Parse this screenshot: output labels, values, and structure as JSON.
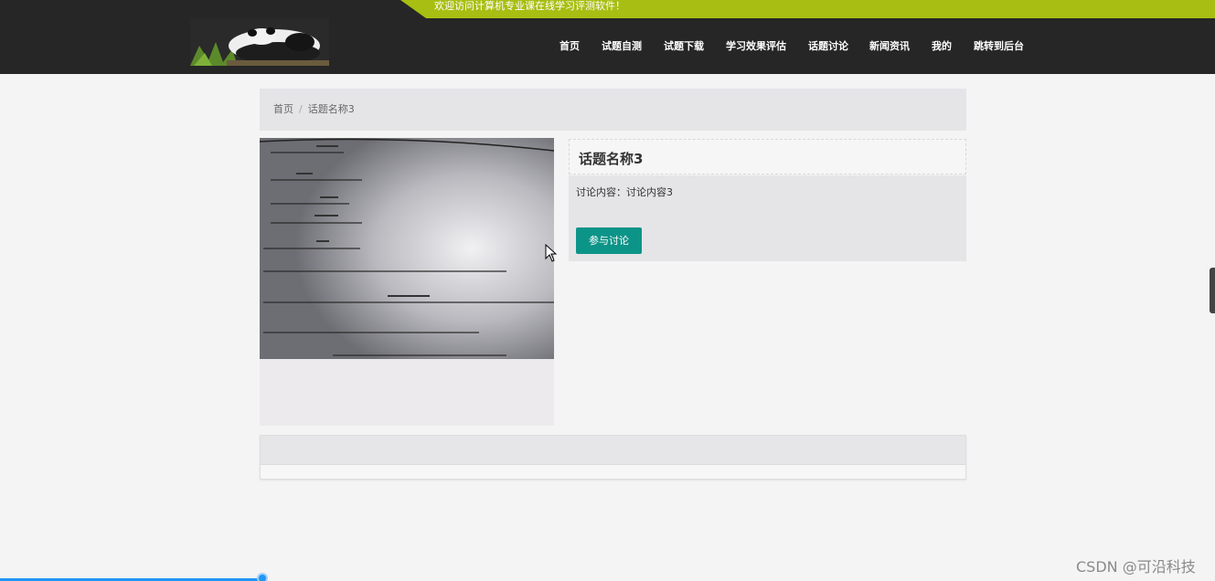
{
  "header": {
    "welcome": "欢迎访问计算机专业课在线学习评测软件！",
    "logo": "panda-logo",
    "nav": [
      {
        "label": "首页"
      },
      {
        "label": "试题自测"
      },
      {
        "label": "试题下载"
      },
      {
        "label": "学习效果评估"
      },
      {
        "label": "话题讨论"
      },
      {
        "label": "新闻资讯"
      },
      {
        "label": "我的"
      },
      {
        "label": "跳转到后台"
      }
    ]
  },
  "breadcrumb": {
    "home": "首页",
    "separator": "/",
    "current": "话题名称3"
  },
  "topic": {
    "title": "话题名称3",
    "content_label": "讨论内容：",
    "content_value": "讨论内容3",
    "join_button": "参与讨论"
  },
  "watermark": "CSDN @可沿科技",
  "colors": {
    "header_bg": "#262626",
    "welcome_bar": "#a8be12",
    "button": "#0d9488",
    "progress": "#2196f3"
  }
}
